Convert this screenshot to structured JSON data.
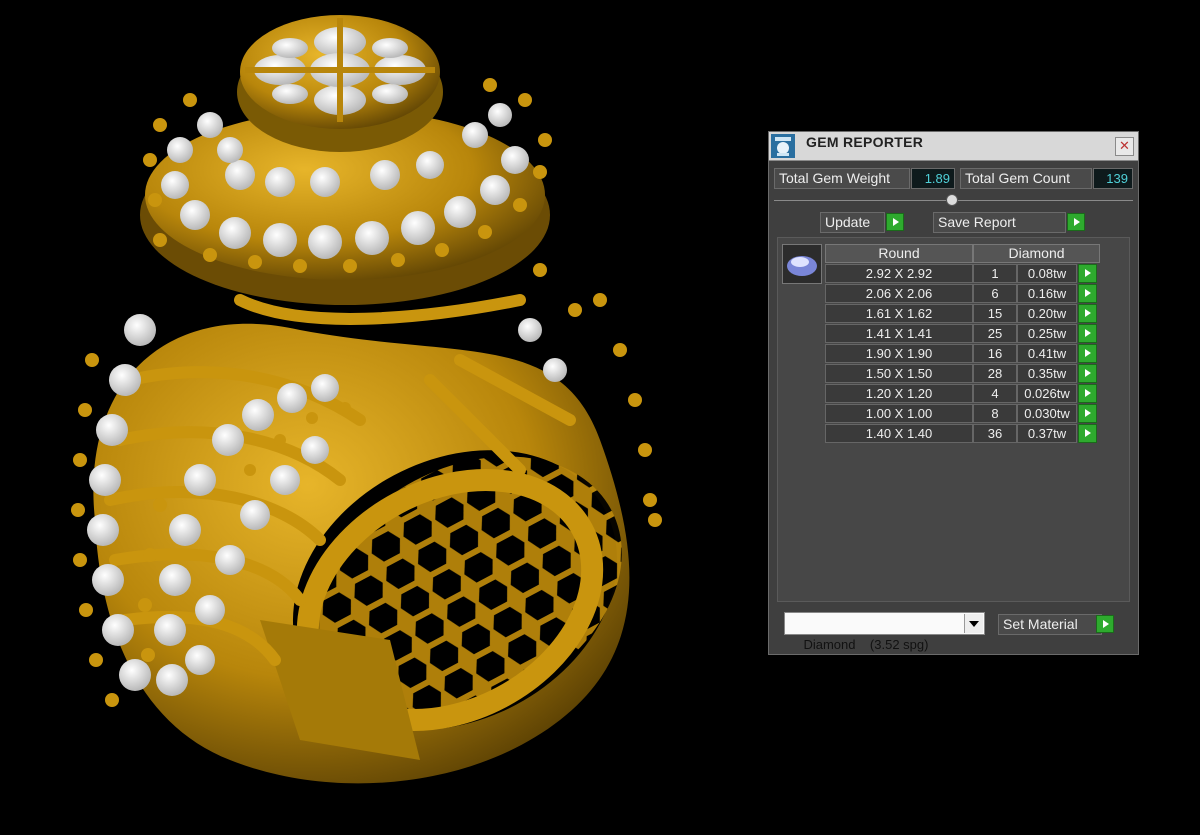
{
  "window": {
    "title": "GEM REPORTER",
    "close_symbol": "✕"
  },
  "summary": {
    "weight_label": "Total Gem Weight",
    "weight_value": "1.89",
    "count_label": "Total Gem Count",
    "count_value": "139"
  },
  "buttons": {
    "update": "Update",
    "save_report": "Save Report",
    "set_material": "Set Material"
  },
  "table": {
    "shape_header": "Round",
    "material_header": "Diamond",
    "rows": [
      {
        "size": "2.92 X 2.92",
        "count": "1",
        "weight": "0.08tw"
      },
      {
        "size": "2.06 X 2.06",
        "count": "6",
        "weight": "0.16tw"
      },
      {
        "size": "1.61 X 1.62",
        "count": "15",
        "weight": "0.20tw"
      },
      {
        "size": "1.41 X 1.41",
        "count": "25",
        "weight": "0.25tw"
      },
      {
        "size": "1.90 X 1.90",
        "count": "16",
        "weight": "0.41tw"
      },
      {
        "size": "1.50 X 1.50",
        "count": "28",
        "weight": "0.35tw"
      },
      {
        "size": "1.20 X 1.20",
        "count": "4",
        "weight": "0.026tw"
      },
      {
        "size": "1.00 X 1.00",
        "count": "8",
        "weight": "0.030tw"
      },
      {
        "size": "1.40 X 1.40",
        "count": "36",
        "weight": "0.37tw"
      }
    ]
  },
  "material_select": {
    "value": "Diamond    (3.52 spg)"
  },
  "colors": {
    "metal": "#c9950e",
    "metal_dark": "#7a5a05",
    "gem": "#f2f2f2",
    "accent_green": "#2eaa2e",
    "value_text": "#4fd0d8"
  }
}
